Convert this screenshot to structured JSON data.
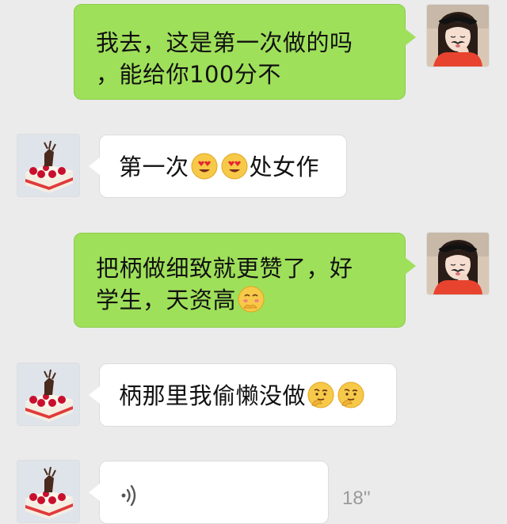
{
  "messages": [
    {
      "side": "right",
      "lines": [
        "我去，这是第一次做的吗",
        "，能给你100分不"
      ],
      "avatar": "girl-avatar"
    },
    {
      "side": "left",
      "text_before": "第一次",
      "emojis_mid": [
        "heart-eyes-emoji",
        "heart-eyes-emoji"
      ],
      "text_after": "处女作",
      "avatar": "cake-avatar"
    },
    {
      "side": "right",
      "lines": [
        "把柄做细致就更赞了，好",
        "学生，天资高"
      ],
      "trailing_emoji": "shy-laugh-emoji",
      "avatar": "girl-avatar"
    },
    {
      "side": "left",
      "text": "柄那里我偷懒没做",
      "trailing_emojis": [
        "thinking-emoji",
        "thinking-emoji"
      ],
      "avatar": "cake-avatar"
    },
    {
      "side": "left",
      "type": "voice",
      "icon": "voice-wave-icon",
      "duration": "18''",
      "avatar": "cake-avatar"
    }
  ],
  "colors": {
    "background": "#ebebeb",
    "outgoing_bubble": "#9fe05a",
    "incoming_bubble": "#ffffff"
  }
}
